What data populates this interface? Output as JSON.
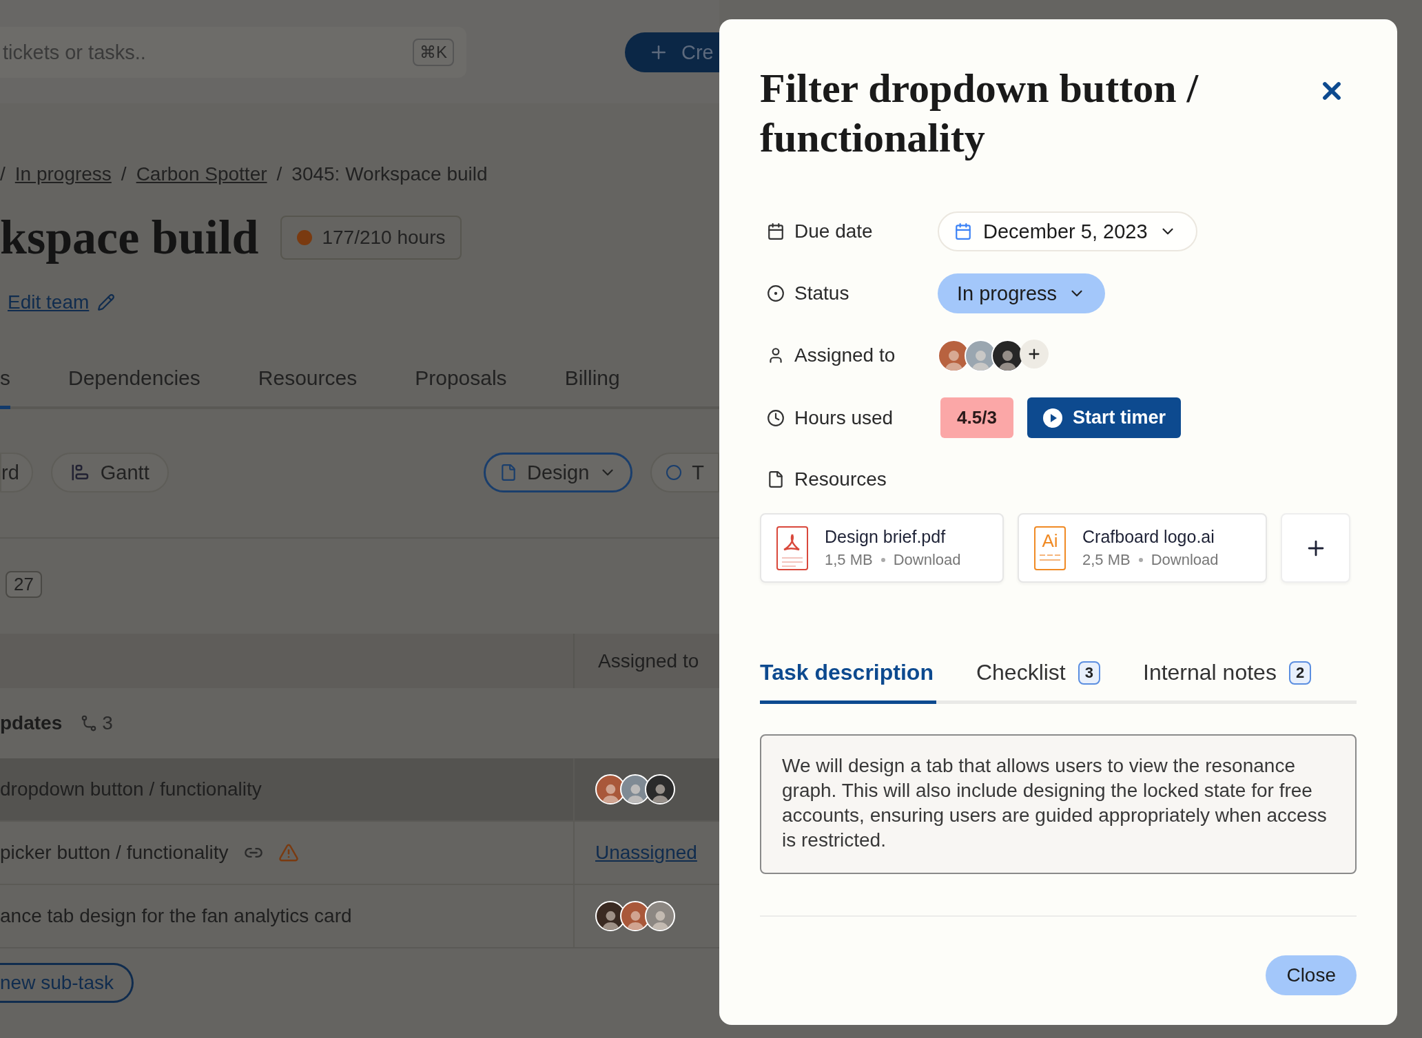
{
  "search": {
    "placeholder": "tickets or tasks..",
    "shortcut": "⌘K"
  },
  "create_button": {
    "label": "Cre"
  },
  "breadcrumb": {
    "separator": "/",
    "items": [
      {
        "label": "In progress",
        "link": true
      },
      {
        "label": "Carbon Spotter",
        "link": true
      },
      {
        "label": "3045: Workspace build",
        "link": false
      }
    ]
  },
  "project": {
    "title": "kspace build",
    "hours": "177/210 hours",
    "edit_team": "Edit team"
  },
  "page_tabs": [
    {
      "label": "s",
      "selected": true
    },
    {
      "label": "Dependencies",
      "selected": false
    },
    {
      "label": "Resources",
      "selected": false
    },
    {
      "label": "Proposals",
      "selected": false
    },
    {
      "label": "Billing",
      "selected": false
    }
  ],
  "view_buttons": [
    {
      "label": "rd",
      "kind": "plain"
    },
    {
      "label": "Gantt",
      "kind": "gantt"
    }
  ],
  "filters": [
    {
      "label": "Design",
      "kind": "dropdown"
    },
    {
      "label": "T",
      "kind": "status"
    }
  ],
  "count_badge": "27",
  "table": {
    "columns": [
      "Assigned to"
    ],
    "group": {
      "name": "pdates",
      "subtasks": "3"
    },
    "rows": [
      {
        "task": "dropdown button / functionality",
        "selected": true,
        "linked": false,
        "warning": false,
        "avatars": [
          {
            "color": "#a9583a"
          },
          {
            "color": "#7f8a94"
          },
          {
            "color": "#2b2b2b"
          }
        ]
      },
      {
        "task": "picker button / functionality",
        "selected": false,
        "linked": true,
        "warning": true,
        "unassigned": "Unassigned"
      },
      {
        "task": "ance tab design for the fan analytics card",
        "selected": false,
        "linked": false,
        "warning": false,
        "avatars": [
          {
            "color": "#3a2a22"
          },
          {
            "color": "#a9583a"
          },
          {
            "color": "#8c8782"
          }
        ]
      }
    ],
    "add_subtask": "new sub-task"
  },
  "modal": {
    "title": "Filter dropdown button / functionality",
    "fields": [
      {
        "kind": "date",
        "label": "Due date",
        "value": "December 5, 2023"
      },
      {
        "kind": "status",
        "label": "Status",
        "value": "In progress"
      },
      {
        "kind": "assignees",
        "label": "Assigned to",
        "avatars": [
          {
            "color": "#b8623f"
          },
          {
            "color": "#9aa6b0"
          },
          {
            "color": "#262626"
          }
        ]
      },
      {
        "kind": "hours",
        "label": "Hours used",
        "value": "4.5/3",
        "action": "Start timer"
      },
      {
        "kind": "resources",
        "label": "Resources"
      }
    ],
    "resources": [
      {
        "kind": "pdf",
        "name": "Design brief.pdf",
        "size": "1,5 MB",
        "action": "Download"
      },
      {
        "kind": "ai",
        "name": "Crafboard logo.ai",
        "size": "2,5 MB",
        "action": "Download",
        "badge": "Ai"
      }
    ],
    "tabs": [
      {
        "label": "Task description",
        "selected": true
      },
      {
        "label": "Checklist",
        "count": "3",
        "selected": false
      },
      {
        "label": "Internal notes",
        "count": "2",
        "selected": false
      }
    ],
    "description": "We will design a tab that allows users to view the resonance graph. This will also include designing the locked state for free accounts, ensuring users are guided appropriately when access is restricted.",
    "close_button": "Close"
  }
}
